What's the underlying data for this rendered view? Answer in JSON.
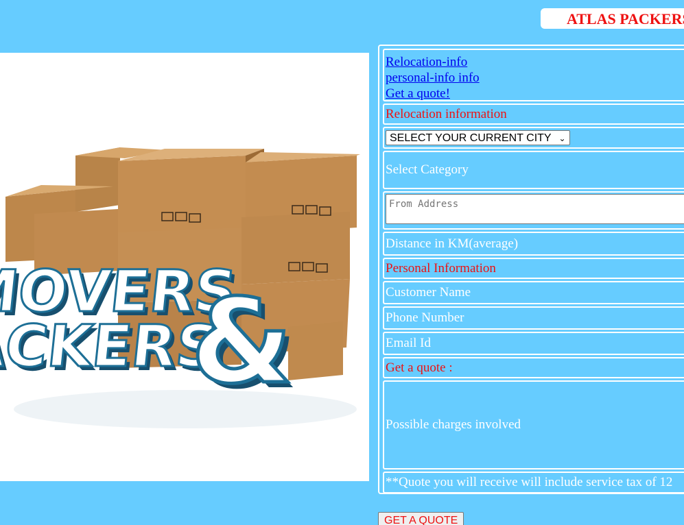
{
  "header": {
    "title": "ATLAS PACKERS"
  },
  "hero": {
    "image_text_line1": "MOVERS",
    "image_text_line2": "PACKERS",
    "image_text_amp": "&"
  },
  "nav": {
    "links": [
      "Relocation-info",
      "personal-info info",
      "Get a quote!"
    ]
  },
  "form": {
    "relocation_heading": "Relocation information",
    "city_select": {
      "selected": "SELECT YOUR CURRENT CITY"
    },
    "category_label": "Select Category",
    "from_address_placeholder": "From Address",
    "distance_label": "Distance in KM(average)",
    "personal_heading": "Personal Information",
    "customer_name_label": "Customer Name",
    "phone_label": "Phone Number",
    "email_label": "Email Id",
    "quote_heading": "Get a quote :",
    "charges_label": "Possible charges involved",
    "tax_note": "**Quote you will receive will include service tax of 12"
  },
  "actions": {
    "get_quote_button": "GET A QUOTE"
  },
  "colors": {
    "background": "#66ccff",
    "heading_red": "#ee1111",
    "link_blue": "#0000ee",
    "box_brown": "#c08a4e",
    "letter_blue": "#1d6f96"
  }
}
